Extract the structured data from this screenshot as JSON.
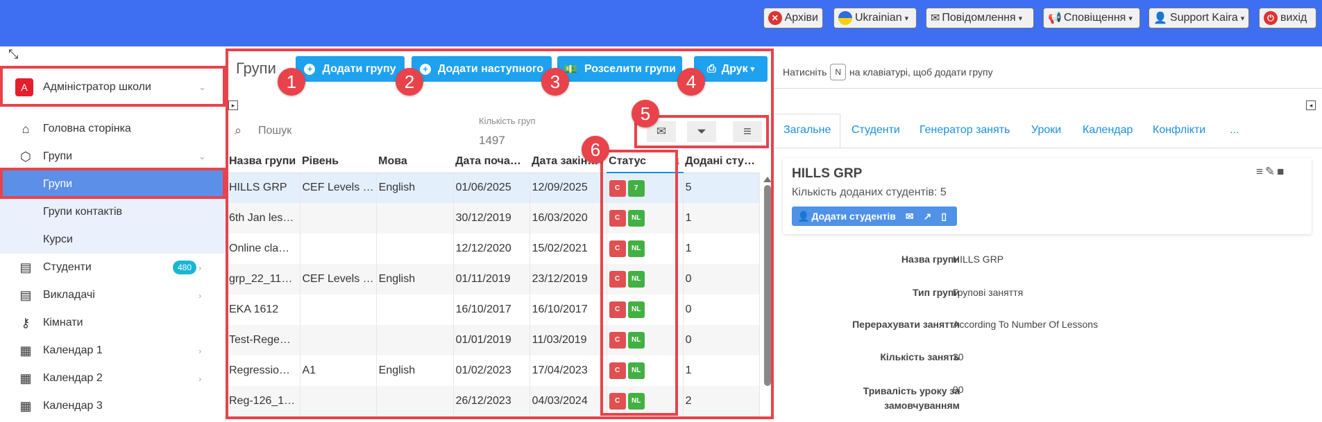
{
  "topbar": {
    "archives": "Архіви",
    "language": "Ukrainian",
    "messages": "Повідомлення",
    "notifications": "Сповіщення",
    "user": "Support Kaira",
    "logout": "вихід"
  },
  "sidebar": {
    "role": "Адміністратор школи",
    "role_initial": "A",
    "items": [
      {
        "label": "Головна сторінка"
      },
      {
        "label": "Групи"
      },
      {
        "label": "Групи"
      },
      {
        "label": "Групи контактів"
      },
      {
        "label": "Курси"
      },
      {
        "label": "Студенти",
        "badge": "480"
      },
      {
        "label": "Викладачі"
      },
      {
        "label": "Кімнати"
      },
      {
        "label": "Календар 1"
      },
      {
        "label": "Календар 2"
      },
      {
        "label": "Календар 3"
      }
    ]
  },
  "toolbar": {
    "title": "Групи",
    "add_group": "Додати групу",
    "add_next": "Додати наступного",
    "distribute": "Розселити групи",
    "print": "Друк",
    "hint_prefix": "Натисніть",
    "hint_key": "N",
    "hint_suffix": "на клавіатурі, щоб додати групу"
  },
  "search": {
    "placeholder": "Пошук",
    "count_label": "Кількість груп",
    "count_value": "1497"
  },
  "callouts": [
    "1",
    "2",
    "3",
    "4",
    "5",
    "6"
  ],
  "table": {
    "headers": [
      "Назва групи",
      "Рівень",
      "Мова",
      "Дата поча…",
      "Дата закін…",
      "Статус",
      "Додані сту…"
    ],
    "rows": [
      {
        "name": "HILLS GRP",
        "level": "CEF Levels …",
        "lang": "English",
        "start": "01/06/2025",
        "end": "12/09/2025",
        "s1": "C",
        "s2": "7",
        "count": "5"
      },
      {
        "name": "6th Jan les…",
        "level": "",
        "lang": "",
        "start": "30/12/2019",
        "end": "16/03/2020",
        "s1": "C",
        "s2": "NL",
        "count": "1"
      },
      {
        "name": "Online cla…",
        "level": "",
        "lang": "",
        "start": "12/12/2020",
        "end": "15/02/2021",
        "s1": "C",
        "s2": "NL",
        "count": "1"
      },
      {
        "name": "grp_22_11…",
        "level": "CEF Levels …",
        "lang": "English",
        "start": "01/11/2019",
        "end": "23/12/2019",
        "s1": "C",
        "s2": "NL",
        "count": "0"
      },
      {
        "name": "EKA 1612",
        "level": "",
        "lang": "",
        "start": "16/10/2017",
        "end": "16/10/2017",
        "s1": "C",
        "s2": "NL",
        "count": "0"
      },
      {
        "name": "Test-Rege…",
        "level": "",
        "lang": "",
        "start": "01/01/2019",
        "end": "11/03/2019",
        "s1": "C",
        "s2": "NL",
        "count": "0"
      },
      {
        "name": "Regressio…",
        "level": "A1",
        "lang": "English",
        "start": "01/02/2023",
        "end": "17/04/2023",
        "s1": "C",
        "s2": "NL",
        "count": "1"
      },
      {
        "name": "Reg-126_1…",
        "level": "",
        "lang": "",
        "start": "26/12/2023",
        "end": "04/03/2024",
        "s1": "C",
        "s2": "NL",
        "count": "2"
      }
    ]
  },
  "detail": {
    "tabs": [
      "Загальне",
      "Студенти",
      "Генератор занять",
      "Уроки",
      "Календар",
      "Конфлікти",
      "..."
    ],
    "title": "HILLS GRP",
    "students_line": "Кількість доданих студентів: 5",
    "add_students": "Додати студентів",
    "fields": [
      {
        "label": "Назва групи",
        "value": "HILLS GRP"
      },
      {
        "label": "Тип групи",
        "value": "Групові заняття"
      },
      {
        "label": "Перерахувати заняття",
        "value": "According To Number Of Lessons"
      },
      {
        "label": "Кількість занять",
        "value": "30"
      },
      {
        "label": "Тривалість уроку за замовчуванням",
        "value": "90"
      }
    ]
  },
  "colors": {
    "topbar": "#3e6ff2",
    "accent": "#1ea1ef",
    "highlight": "#e8434b",
    "sidebar_active": "#5b8fe8"
  }
}
